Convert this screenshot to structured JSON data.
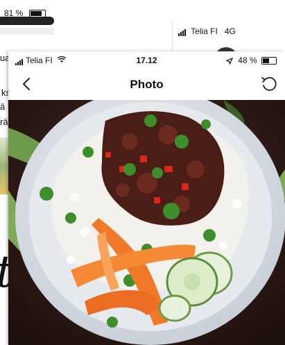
{
  "background_left": {
    "battery_text": "81 %",
    "fragments": [
      "ua",
      "ks",
      "ä",
      "rä"
    ],
    "big_letter": "t"
  },
  "background_right": {
    "carrier": "Telia FI",
    "network": "4G"
  },
  "status_bar": {
    "carrier": "Telia FI",
    "time": "17.12",
    "battery_text": "48 %",
    "battery_level": 0.48
  },
  "nav": {
    "title": "Photo",
    "back_icon": "chevron-left-icon",
    "rotate_icon": "rotate-ccw-icon"
  },
  "photo": {
    "subject": "rice-bowl-photo"
  },
  "colors": {
    "plate": "#dfe4ea",
    "rice": "#f3f1ec",
    "stew": "#4a1d17",
    "carrot": "#f07a2a",
    "herb": "#3e8f2c",
    "cucumber": "#cfe6b6",
    "table": "#2a1713"
  }
}
